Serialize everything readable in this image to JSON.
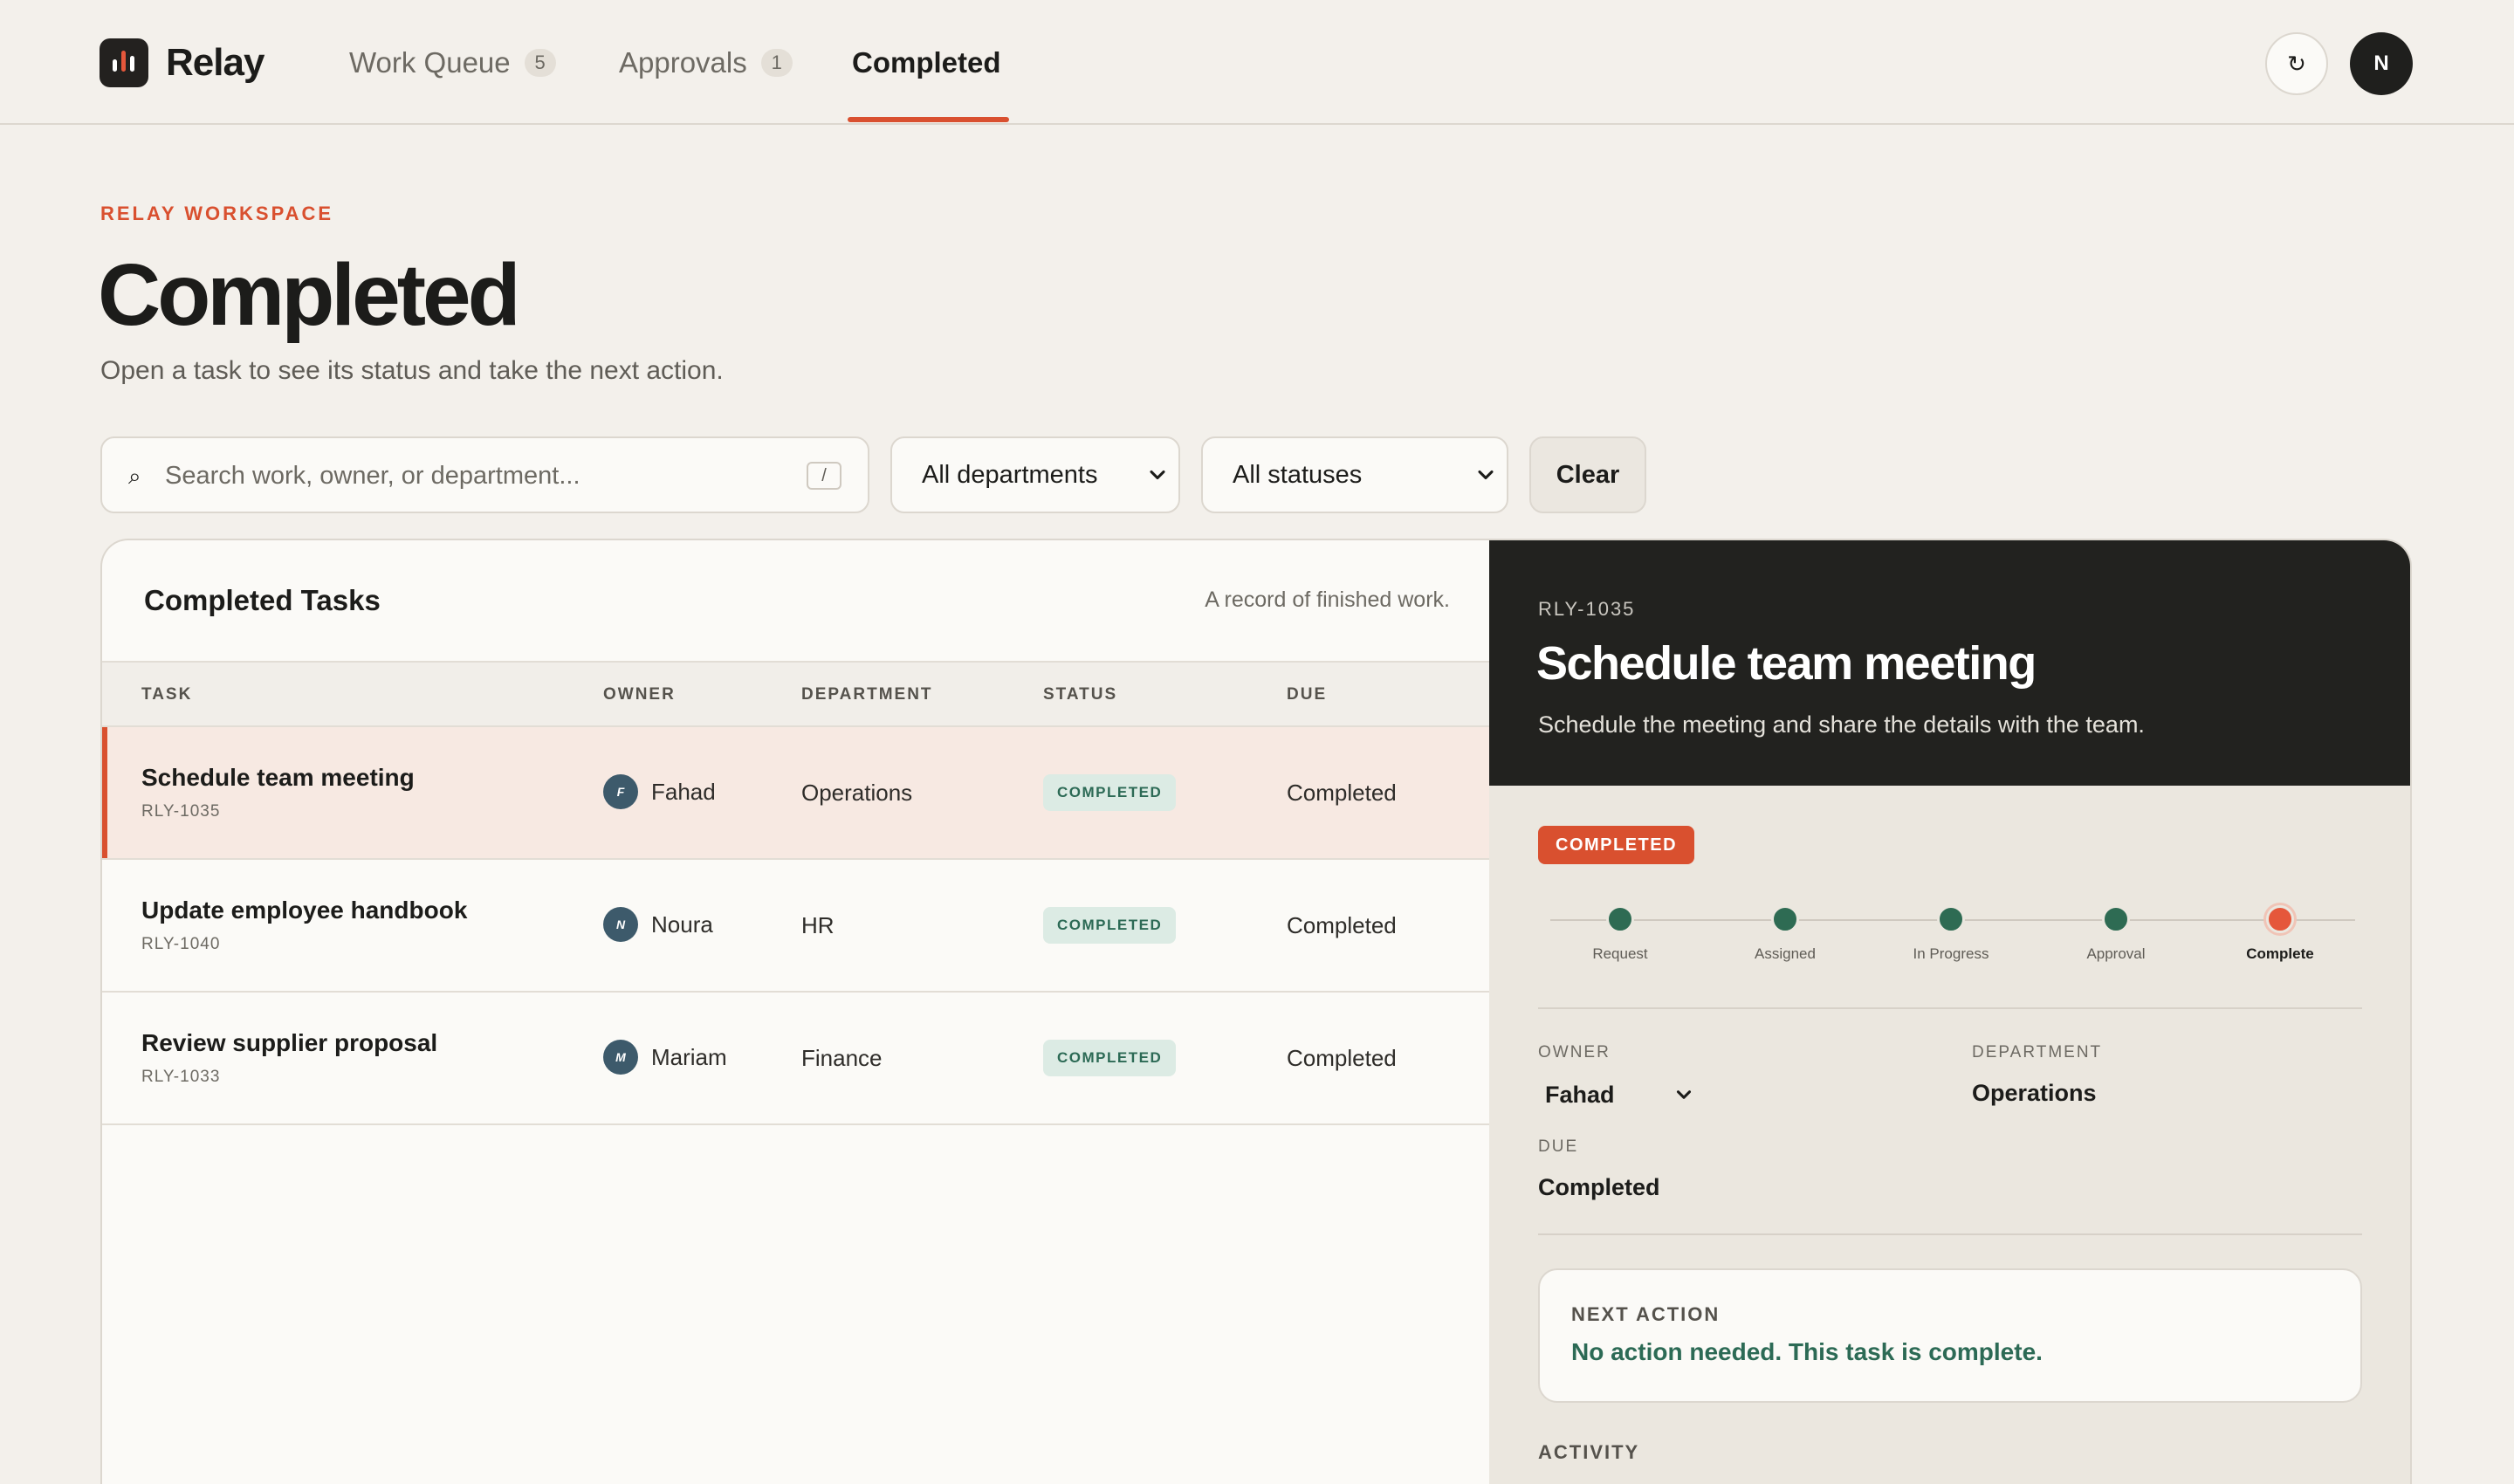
{
  "app": {
    "name": "Relay"
  },
  "nav": {
    "tabs": [
      {
        "label": "Work Queue",
        "count": "5"
      },
      {
        "label": "Approvals",
        "count": "1"
      },
      {
        "label": "Completed"
      }
    ],
    "refresh_icon": "↻",
    "user_initial": "N"
  },
  "header": {
    "eyebrow": "RELAY WORKSPACE",
    "title": "Completed",
    "subtitle": "Open a task to see its status and take the next action."
  },
  "filters": {
    "search_placeholder": "Search work, owner, or department...",
    "search_shortcut": "/",
    "department": "All departments",
    "status": "All statuses",
    "clear_label": "Clear"
  },
  "list": {
    "title": "Completed Tasks",
    "subtitle": "A record of finished work.",
    "columns": [
      "TASK",
      "OWNER",
      "DEPARTMENT",
      "STATUS",
      "DUE"
    ],
    "rows": [
      {
        "name": "Schedule team meeting",
        "id": "RLY-1035",
        "owner": "Fahad",
        "owner_initial": "F",
        "department": "Operations",
        "status": "COMPLETED",
        "due": "Completed"
      },
      {
        "name": "Update employee handbook",
        "id": "RLY-1040",
        "owner": "Noura",
        "owner_initial": "N",
        "department": "HR",
        "status": "COMPLETED",
        "due": "Completed"
      },
      {
        "name": "Review supplier proposal",
        "id": "RLY-1033",
        "owner": "Mariam",
        "owner_initial": "M",
        "department": "Finance",
        "status": "COMPLETED",
        "due": "Completed"
      }
    ]
  },
  "detail": {
    "id": "RLY-1035",
    "title": "Schedule team meeting",
    "description": "Schedule the meeting and share the details with the team.",
    "status": "COMPLETED",
    "steps": [
      "Request",
      "Assigned",
      "In Progress",
      "Approval",
      "Complete"
    ],
    "owner_label": "OWNER",
    "owner_value": "Fahad",
    "department_label": "DEPARTMENT",
    "department_value": "Operations",
    "due_label": "DUE",
    "due_value": "Completed",
    "next_action_label": "NEXT ACTION",
    "next_action_text": "No action needed. This task is complete.",
    "activity_label": "ACTIVITY"
  },
  "colors": {
    "accent": "#d9502f",
    "success": "#2e6b53",
    "background": "#f3f0eb",
    "dark_panel": "#22221f"
  }
}
